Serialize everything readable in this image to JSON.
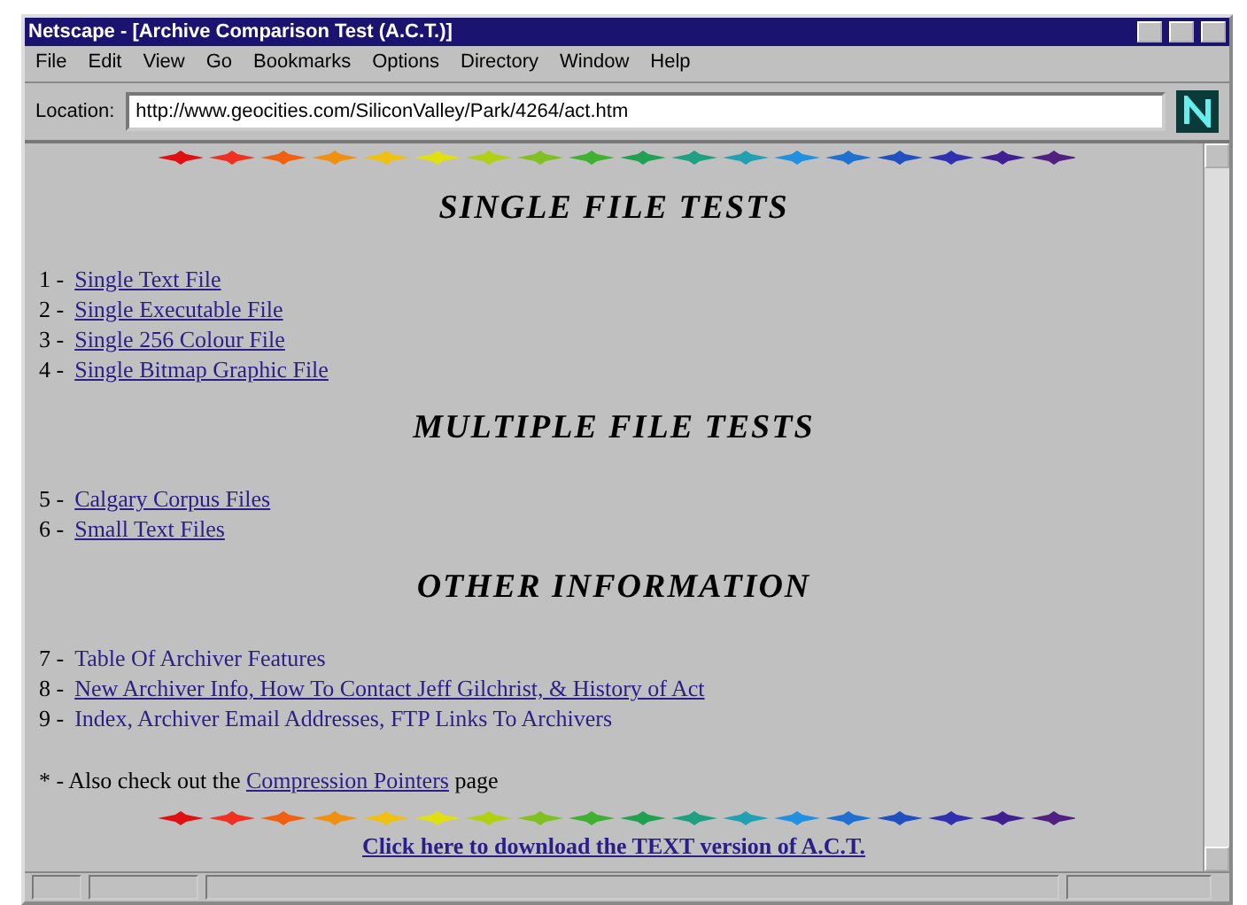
{
  "window": {
    "title": "Netscape - [Archive Comparison Test (A.C.T.)]"
  },
  "menu": [
    "File",
    "Edit",
    "View",
    "Go",
    "Bookmarks",
    "Options",
    "Directory",
    "Window",
    "Help"
  ],
  "location": {
    "label": "Location:",
    "value": "http://www.geocities.com/SiliconValley/Park/4264/act.htm"
  },
  "sections": [
    {
      "heading": "SINGLE FILE TESTS",
      "items": [
        {
          "number": "1 -",
          "link": "Single Text File",
          "underlined": true
        },
        {
          "number": "2 -",
          "link": "Single Executable File",
          "underlined": true
        },
        {
          "number": "3 -",
          "link": "Single 256 Colour File",
          "underlined": true
        },
        {
          "number": "4 -",
          "link": "Single Bitmap Graphic File",
          "underlined": true
        }
      ]
    },
    {
      "heading": "MULTIPLE FILE TESTS",
      "items": [
        {
          "number": "5 -",
          "link": "Calgary Corpus Files",
          "underlined": true
        },
        {
          "number": "6 -",
          "link": "Small Text Files",
          "underlined": true
        }
      ]
    },
    {
      "heading": "OTHER INFORMATION",
      "items": [
        {
          "number": "7 -",
          "link": "Table Of Archiver Features",
          "underlined": false
        },
        {
          "number": "8 -",
          "link": "New Archiver Info, How To Contact Jeff Gilchrist, & History of Act",
          "underlined": true
        },
        {
          "number": "9 -",
          "link": "Index, Archiver Email Addresses, FTP Links To Archivers",
          "underlined": false
        }
      ]
    }
  ],
  "note": {
    "bullet": "*",
    "before": "- Also check out the",
    "link": "Compression Pointers",
    "after": "page"
  },
  "download": "Click here to download the TEXT version of A.C.T."
}
